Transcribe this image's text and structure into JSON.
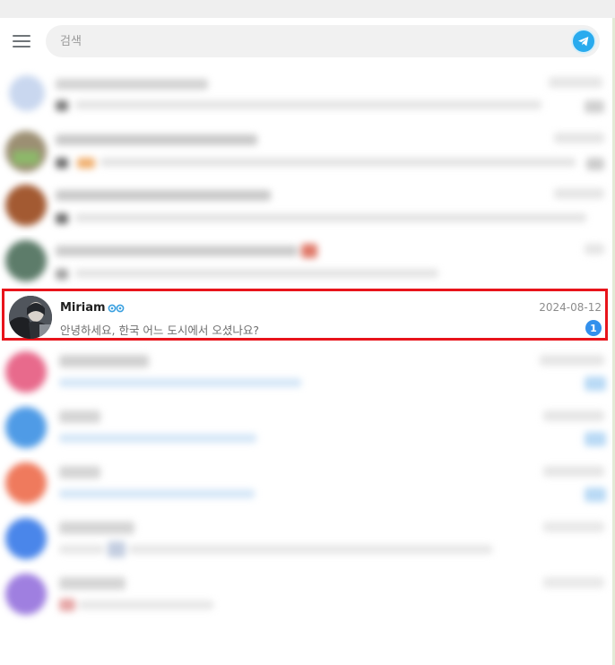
{
  "search": {
    "placeholder": "검색"
  },
  "icons": {
    "menu": "hamburger-menu-icon",
    "logo": "telegram-logo-icon"
  },
  "colors": {
    "accent": "#3390ec",
    "highlight_border": "#e8141b",
    "logo": "#2aabee"
  },
  "selected_chat": {
    "name": "Miriam",
    "date": "2024-08-12",
    "preview": "안녕하세요, 한국 어느 도시에서 오셨나요?",
    "unread": "1"
  }
}
